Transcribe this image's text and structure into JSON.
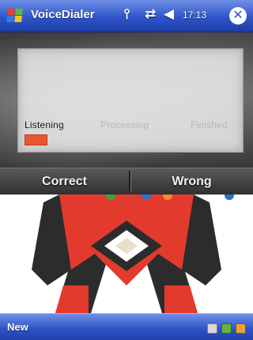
{
  "window": {
    "app_title": "VoiceDialer",
    "clock": "17:13",
    "icons": [
      "start-flag-icon",
      "signal-icon",
      "sync-icon",
      "volume-icon",
      "close-icon"
    ]
  },
  "dialer": {
    "stages": {
      "listening": "Listening",
      "processing": "Processing",
      "finished": "Finished"
    },
    "active_stage": "Listening",
    "progress": 0.1,
    "buttons": {
      "correct": "Correct",
      "wrong": "Wrong"
    }
  },
  "menubar": {
    "left_label": "New",
    "tray_icons": [
      "connectivity-icon",
      "sync-tray-icon",
      "battery-icon"
    ]
  },
  "colors": {
    "title_bar": "#2f54c9",
    "progress_fill": "#e8562e",
    "cartoon_red": "#e23b2e"
  }
}
